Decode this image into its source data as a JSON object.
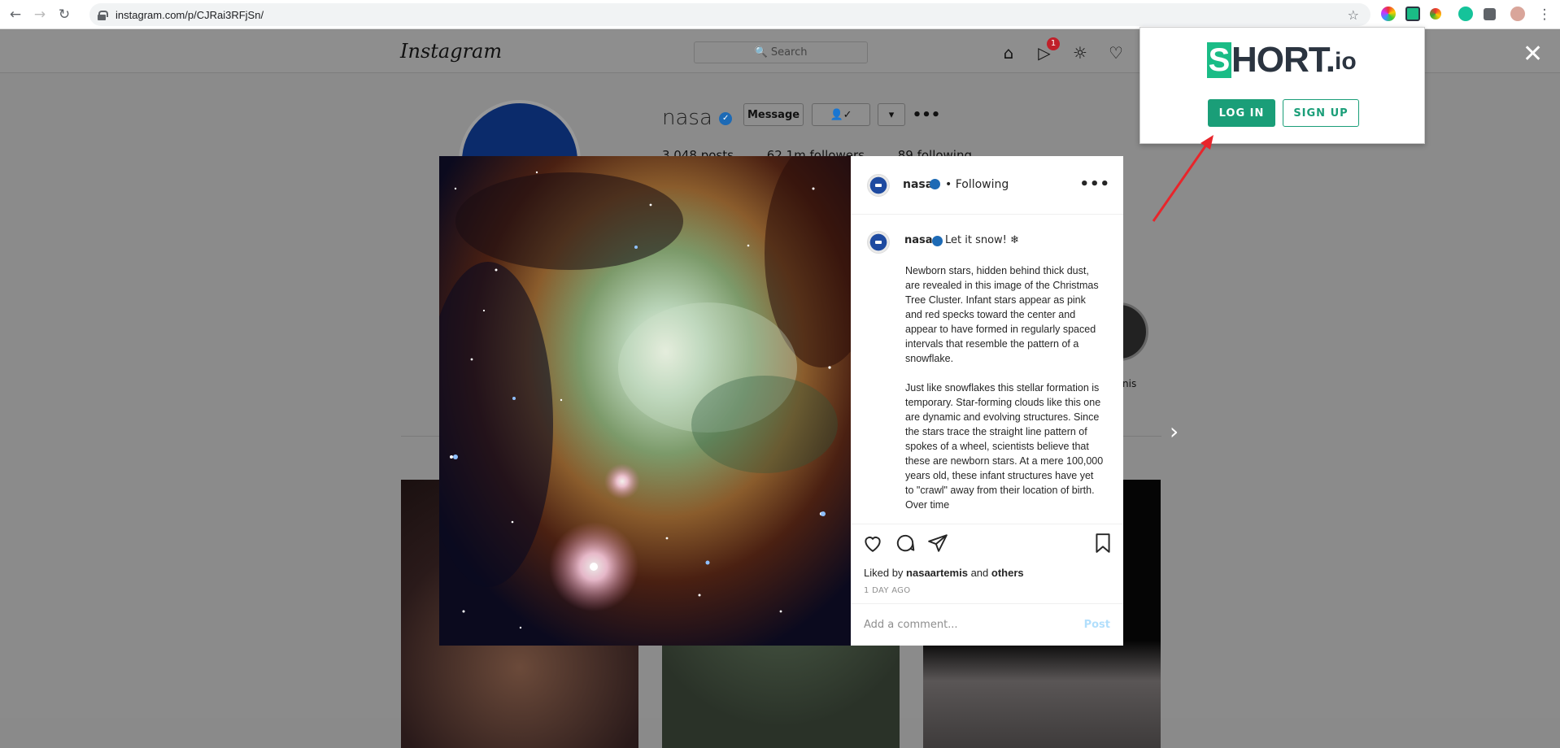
{
  "browser": {
    "url": "instagram.com/p/CJRai3RFjSn/"
  },
  "instagram": {
    "logo": "Instagram",
    "search_placeholder": "Search",
    "notification_count": "1",
    "profile": {
      "username": "nasa",
      "message_label": "Message",
      "posts": "3,048 posts",
      "followers": "62.1m followers",
      "following": "89 following",
      "highlight_label": "nis"
    }
  },
  "post": {
    "username": "nasa",
    "follow_status": "• Following",
    "caption_first": "Let it snow! ❄",
    "caption_paragraphs": [
      "Newborn stars, hidden behind thick dust, are revealed in this image of the Christmas Tree Cluster. Infant stars appear as pink and red specks toward the center and appear to have formed in regularly spaced intervals that resemble the pattern of a snowflake.",
      "Just like snowflakes this stellar formation is temporary. Star-forming clouds like this one are dynamic and evolving structures. Since the stars trace the straight line pattern of spokes of a wheel, scientists believe that these are newborn stars. At a mere 100,000 years old, these infant structures have yet to \"crawl\" away from their location of birth. Over time"
    ],
    "liked_by_prefix": "Liked by",
    "liked_by_user": "nasaartemis",
    "liked_by_and": "and",
    "liked_by_others": "others",
    "time_ago": "1 DAY AGO",
    "comment_placeholder": "Add a comment...",
    "post_label": "Post"
  },
  "shortio": {
    "logo_text": "HORT.",
    "logo_s": "S",
    "logo_io": "io",
    "login_label": "LOG IN",
    "signup_label": "SIGN UP"
  },
  "colors": {
    "shortio_green": "#1a9e78",
    "annotation_red": "#e8252b"
  }
}
